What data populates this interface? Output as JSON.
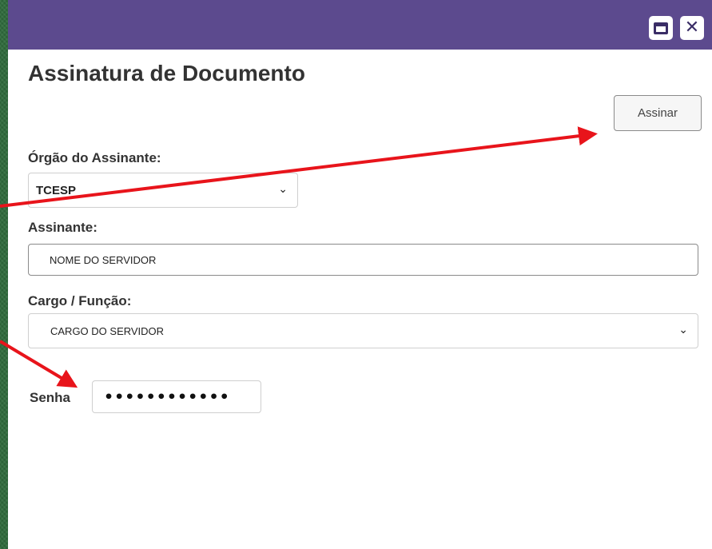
{
  "dialog": {
    "title": "Assinatura de Documento",
    "sign_button": {
      "label": "Assinar"
    }
  },
  "orgao": {
    "label": "Órgão do Assinante:",
    "selected": "TCESP"
  },
  "assinante": {
    "label": "Assinante:",
    "value": "NOME DO SERVIDOR"
  },
  "cargo": {
    "label": "Cargo / Função:",
    "selected": "CARGO DO SERVIDOR"
  },
  "senha": {
    "label": "Senha",
    "masked_value": "••••••••••••"
  },
  "icons": {
    "maximize": "maximize-icon",
    "close": "close-icon",
    "chevron": "chevron-down-icon"
  },
  "colors": {
    "titlebar": "#5c4a8e",
    "background": "#2f6b3c",
    "annotation_arrow": "#e8141b"
  }
}
